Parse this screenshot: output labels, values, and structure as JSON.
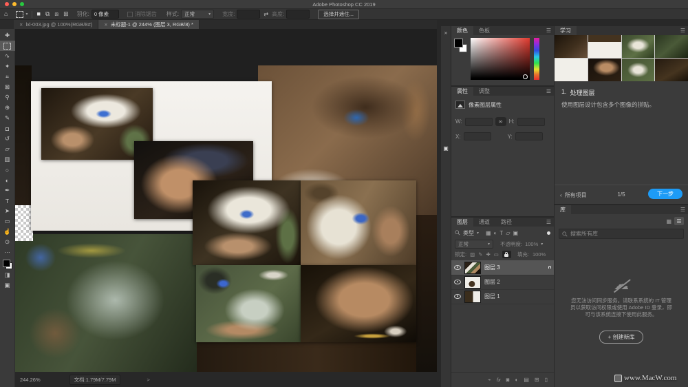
{
  "app": {
    "title": "Adobe Photoshop CC 2019"
  },
  "options_bar": {
    "feather_label": "羽化:",
    "feather_value": "0 像素",
    "antialias_label": "消除锯齿",
    "style_label": "样式:",
    "style_value": "正常",
    "width_label": "宽度:",
    "height_label": "高度:",
    "select_mask_button": "选择并遮住..."
  },
  "document_tabs": [
    {
      "label": "lxl-003.jpg @ 100%(RGB/8#)",
      "active": false
    },
    {
      "label": "未标题-1 @ 244% (图层 3, RGB/8) *",
      "active": true
    }
  ],
  "toolbar": {
    "tools": [
      {
        "name": "move",
        "glyph": "✚"
      },
      {
        "name": "marquee",
        "glyph": "",
        "selected": true
      },
      {
        "name": "lasso",
        "glyph": "∿"
      },
      {
        "name": "quick-selection",
        "glyph": "✦"
      },
      {
        "name": "crop",
        "glyph": "⌗"
      },
      {
        "name": "frame",
        "glyph": "⊠"
      },
      {
        "name": "eyedropper",
        "glyph": "⚲"
      },
      {
        "name": "spot-healing",
        "glyph": "⊕"
      },
      {
        "name": "brush",
        "glyph": "✎"
      },
      {
        "name": "clone-stamp",
        "glyph": "◘"
      },
      {
        "name": "history-brush",
        "glyph": "↺"
      },
      {
        "name": "eraser",
        "glyph": "▱"
      },
      {
        "name": "gradient",
        "glyph": "▥"
      },
      {
        "name": "blur",
        "glyph": "○"
      },
      {
        "name": "dodge",
        "glyph": "◐"
      },
      {
        "name": "pen",
        "glyph": "✒"
      },
      {
        "name": "type",
        "glyph": "T"
      },
      {
        "name": "path-selection",
        "glyph": "➤"
      },
      {
        "name": "rectangle",
        "glyph": "▭"
      },
      {
        "name": "hand",
        "glyph": "☝"
      },
      {
        "name": "zoom",
        "glyph": "⊙"
      },
      {
        "name": "toolbar-options",
        "glyph": "⋯"
      },
      {
        "name": "color-swatches",
        "glyph": ""
      },
      {
        "name": "quick-mask",
        "glyph": "◨"
      },
      {
        "name": "screen-mode",
        "glyph": "▣"
      }
    ]
  },
  "status_bar": {
    "zoom": "244.26%",
    "doc_info": "文档:1.79M/7.79M",
    "caret": ">"
  },
  "panels": {
    "color": {
      "tabs": [
        "颜色",
        "色板"
      ]
    },
    "properties": {
      "tabs": [
        "属性",
        "调整"
      ],
      "header": "像素图层属性",
      "w_label": "W:",
      "h_label": "H:",
      "x_label": "X:",
      "y_label": "Y:",
      "w_value": "",
      "h_value": "",
      "x_value": "",
      "y_value": ""
    },
    "layers": {
      "tabs": [
        "图层",
        "通道",
        "路径"
      ],
      "filter_label": "类型",
      "blend_mode": "正常",
      "opacity_label": "不透明度:",
      "opacity_value": "100%",
      "lock_label": "锁定:",
      "fill_label": "填充:",
      "fill_value": "100%",
      "items": [
        {
          "name": "图层 3",
          "selected": true,
          "locked": true
        },
        {
          "name": "图层 2",
          "selected": false,
          "locked": false
        },
        {
          "name": "图层 1",
          "selected": false,
          "locked": false
        }
      ]
    },
    "learn": {
      "tab": "学习",
      "step_number": "1.",
      "step_title": "处理图层",
      "step_desc": "使用图层设计包含多个图像的拼贴。",
      "back_label": "所有项目",
      "progress": "1/5",
      "next_button": "下一步"
    },
    "libraries": {
      "tab": "库",
      "search_placeholder": "搜索所有库",
      "offline_message": "您无法访问同步服务。请联系系统的 IT 管理员以获取访问权限或使用 Adobe ID 登录，即可与该系统连接下使用此服务。",
      "create_button": "+ 创建新库"
    }
  },
  "icons": {
    "close": "✕",
    "menu": "☰",
    "caret_down": "▾",
    "home": "⌂",
    "swap": "⇄",
    "back": "‹",
    "collapse": "»",
    "dock_panel": "▣",
    "link_fields": "∞",
    "grid_view": "▦",
    "list_view": "☰",
    "selection_modes": [
      "■",
      "⧉",
      "⧈",
      "⊞"
    ],
    "filter_icons": [
      "▦",
      "◐",
      "T",
      "▱",
      "▣"
    ],
    "lock_icons": [
      "▨",
      "✎",
      "✚",
      "▭"
    ],
    "bottom_icons": [
      "⌁",
      "fx",
      "◙",
      "◐",
      "▤",
      "⊞",
      "▯"
    ],
    "cloud": "☁"
  },
  "watermark": "www.MacW.com",
  "colors": {
    "accent_blue": "#1d9bf6",
    "hue_red": "#e13b30",
    "canvas_bg": "#202020"
  }
}
